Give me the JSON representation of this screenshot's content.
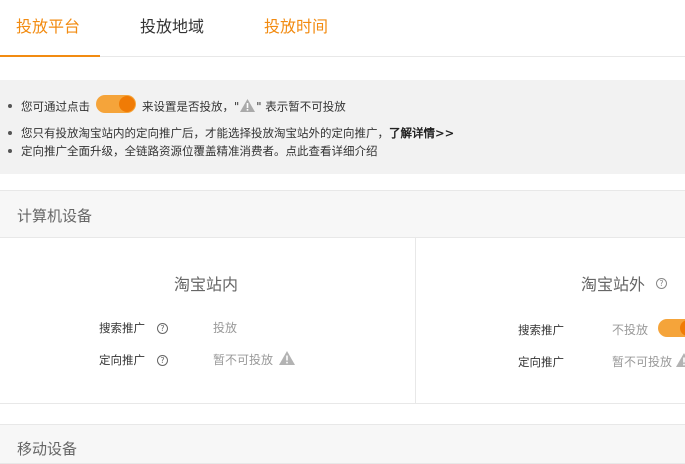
{
  "tabs": [
    {
      "label": "投放平台",
      "state": "active"
    },
    {
      "label": "投放地域",
      "state": "normal"
    },
    {
      "label": "投放时间",
      "state": "orange"
    }
  ],
  "notice": {
    "line1_prefix": "您可通过点击",
    "line1_middle": "来设置是否投放，\"",
    "line1_suffix": "\" 表示暂不可投放",
    "line2_text": "您只有投放淘宝站内的定向推广后，才能选择投放淘宝站外的定向推广，",
    "line2_link": "了解详情>>",
    "line3_text": "定向推广全面升级，全链路资源位覆盖精准消费者。点此查看详细介绍"
  },
  "sections": {
    "computer": "计算机设备",
    "mobile": "移动设备"
  },
  "panels": {
    "inside": {
      "title": "淘宝站内",
      "rows": [
        {
          "label": "搜索推广",
          "value": "投放"
        },
        {
          "label": "定向推广",
          "value": "暂不可投放"
        }
      ]
    },
    "outside": {
      "title": "淘宝站外",
      "rows": [
        {
          "label": "搜索推广",
          "value": "不投放"
        },
        {
          "label": "定向推广",
          "value": "暂不可投放"
        }
      ]
    }
  },
  "icons": {
    "help": "?",
    "warning": "warning-triangle-icon",
    "toggle": "toggle-switch-icon"
  },
  "colors": {
    "accent": "#f28b11",
    "toggle": "#f5a43a",
    "muted": "#999999"
  }
}
